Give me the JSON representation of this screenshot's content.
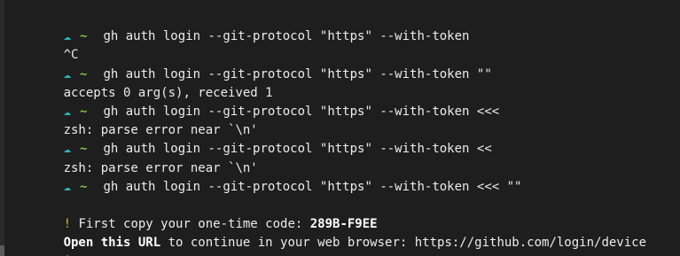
{
  "terminal": {
    "prompt_icon": "☁",
    "prompt_dir": "~",
    "scrollbar": true,
    "lines": [
      {
        "type": "prompt",
        "cmd": "gh auth login --git-protocol \"https\" --with-token"
      },
      {
        "type": "output",
        "text": "^C"
      },
      {
        "type": "prompt",
        "cmd": "gh auth login --git-protocol \"https\" --with-token \"\""
      },
      {
        "type": "output",
        "text": "accepts 0 arg(s), received 1"
      },
      {
        "type": "prompt",
        "cmd": "gh auth login --git-protocol \"https\" --with-token <<<"
      },
      {
        "type": "output",
        "text": "zsh: parse error near `\\n'"
      },
      {
        "type": "prompt",
        "cmd": "gh auth login --git-protocol \"https\" --with-token <<"
      },
      {
        "type": "output",
        "text": "zsh: parse error near `\\n'"
      },
      {
        "type": "prompt",
        "cmd": "gh auth login --git-protocol \"https\" --with-token <<< \"\""
      },
      {
        "type": "blank",
        "text": ""
      }
    ],
    "auth": {
      "bang": "!",
      "copy_text": " First copy your one-time code: ",
      "code": "289B-F9EE",
      "open_prefix": "Open this URL",
      "open_rest": " to continue in your web browser: https://github.com/login/device"
    },
    "final_prompt": "$"
  }
}
